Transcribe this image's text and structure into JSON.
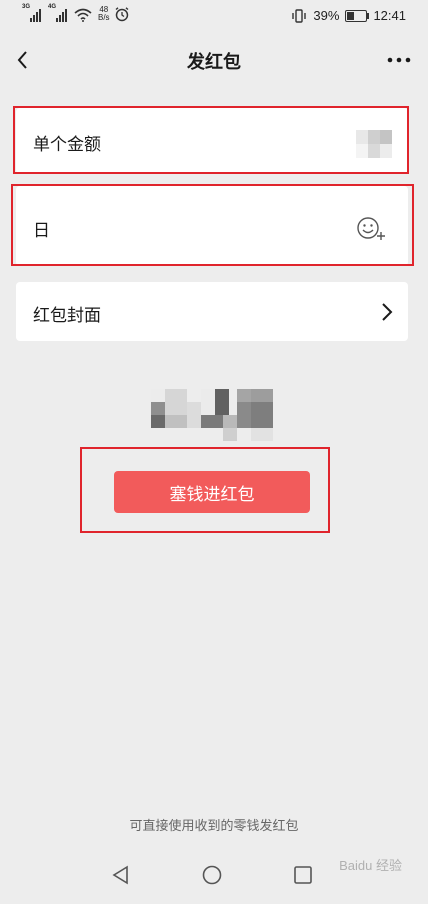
{
  "status_bar": {
    "net1": "3G",
    "net2": "4G",
    "speed_value": "48",
    "speed_unit": "B/s",
    "battery_percent": "39%",
    "battery_level": 0.39,
    "time": "12:41"
  },
  "header": {
    "title": "发红包"
  },
  "form": {
    "amount_label": "单个金额",
    "message_value": "日",
    "cover_label": "红包封面",
    "submit_label": "塞钱进红包"
  },
  "footer": {
    "hint": "可直接使用收到的零钱发红包"
  },
  "watermark": "Baidu 经验",
  "colors": {
    "accent": "#f25b5b",
    "highlight": "#e0242c",
    "background": "#ededed"
  },
  "icons": {
    "back": "chevron-left-icon",
    "more": "more-dots-icon",
    "emoji": "emoji-add-icon",
    "cover_arrow": "chevron-right-icon",
    "system_back": "triangle-back-icon",
    "system_home": "circle-home-icon",
    "system_recent": "square-recent-icon"
  }
}
